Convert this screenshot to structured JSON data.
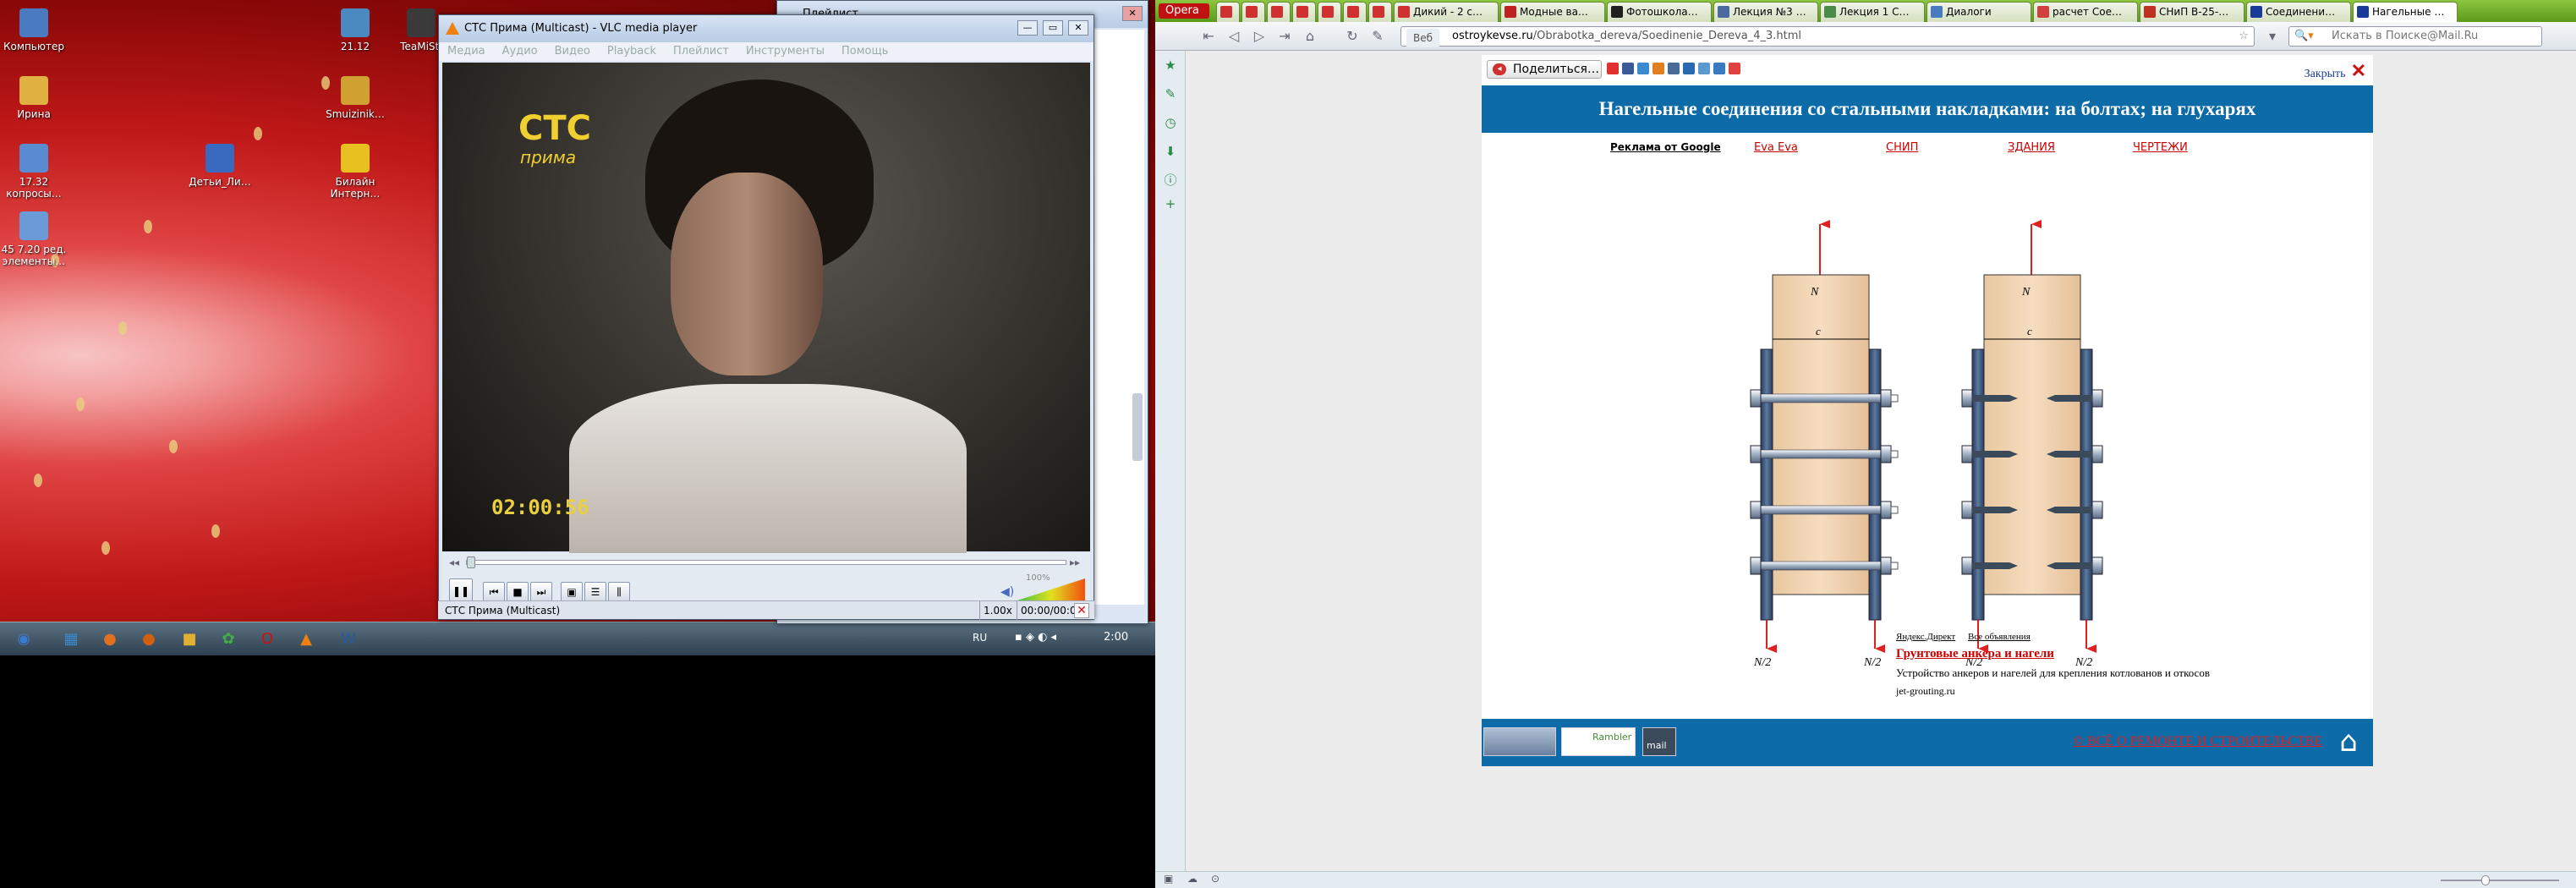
{
  "desktop": {
    "icons": [
      {
        "label": "Компьютер",
        "color": "#4a7ac0"
      },
      {
        "label": "Ирина",
        "color": "#e0b040"
      },
      {
        "label": "17.32 копросы…",
        "color": "#5a8ad0"
      },
      {
        "label": "45 7.20 ред. элементы…",
        "color": "#6a9ad8"
      },
      {
        "label": "21.12",
        "color": "#4a8ac0"
      },
      {
        "label": "TeaMiStI",
        "color": "#3a3a3a"
      },
      {
        "label": "Smuizinik…",
        "color": "#d0a030"
      },
      {
        "label": "Детьи_Ли…",
        "color": "#3a6ac0"
      },
      {
        "label": "Билайн Интерн…",
        "color": "#e8c020"
      }
    ]
  },
  "taskbar": {
    "lang": "RU",
    "clock": "2:00",
    "items": [
      {
        "name": "start-button",
        "glyph": "◉",
        "color": "#3a7ad0"
      },
      {
        "name": "explorer",
        "glyph": "▦",
        "color": "#3a8ad0"
      },
      {
        "name": "firefox",
        "glyph": "●",
        "color": "#e07020"
      },
      {
        "name": "app-orange",
        "glyph": "●",
        "color": "#d06010"
      },
      {
        "name": "folder",
        "glyph": "■",
        "color": "#e0b030"
      },
      {
        "name": "icq",
        "glyph": "✿",
        "color": "#40b040"
      },
      {
        "name": "opera",
        "glyph": "O",
        "color": "#d01010"
      },
      {
        "name": "vlc",
        "glyph": "▲",
        "color": "#f08010"
      },
      {
        "name": "word",
        "glyph": "W",
        "color": "#2a5aa0"
      }
    ]
  },
  "vlc": {
    "title": "СТС Прима (Multicast) - VLC media player",
    "menu": [
      "Медиа",
      "Аудио",
      "Видео",
      "Playback",
      "Плейлист",
      "Инструменты",
      "Помощь"
    ],
    "channel_logo": "СТС",
    "channel_logo_sub": "прима",
    "timestamp": "02:00:56",
    "status_left": "СТС Прима (Multicast)",
    "speed": "1.00x",
    "time": "00:00/00:00",
    "volume": "100%"
  },
  "playlist": {
    "title": "Плейлист"
  },
  "opera": {
    "opera_label": "Opera",
    "tabs": [
      {
        "label": "",
        "color": "#d03030"
      },
      {
        "label": "",
        "color": "#d03030"
      },
      {
        "label": "",
        "color": "#d03030"
      },
      {
        "label": "",
        "color": "#d03030"
      },
      {
        "label": "",
        "color": "#d03030"
      },
      {
        "label": "",
        "color": "#d03030"
      },
      {
        "label": "",
        "color": "#d03030"
      },
      {
        "label": "Дикий - 2 с…",
        "color": "#d03030"
      },
      {
        "label": "Модные ва…",
        "color": "#c02020"
      },
      {
        "label": "Фотошкола…",
        "color": "#202020"
      },
      {
        "label": "Лекция №3 …",
        "color": "#4a6aa0"
      },
      {
        "label": "Лекция 1 С…",
        "color": "#4a8a4a"
      },
      {
        "label": "Диалоги",
        "color": "#4a7ac0"
      },
      {
        "label": "расчет Сое…",
        "color": "#d04040"
      },
      {
        "label": "СНиП В-25-…",
        "color": "#c03020"
      },
      {
        "label": "Соединени…",
        "color": "#1a3a9a"
      },
      {
        "label": "Нагельные …",
        "color": "#1a3a9a"
      }
    ],
    "address_prefix": "Веб",
    "address_domain": "ostroykevse.ru",
    "address_path": "/Obrabotka_dereva/Soedinenie_Dereva_4_3.html",
    "search_placeholder": "Искать в Поиске@Mail.Ru"
  },
  "page": {
    "share_label": "Поделиться…",
    "close_label": "Закрыть",
    "title": "Нагельные соединения со стальными накладками: на болтах; на глухарях",
    "ad_google": "Реклама от Google",
    "ad_links": [
      "Eva Eva",
      "СНИП",
      "ЗДАНИЯ",
      "ЧЕРТЕЖИ"
    ],
    "yandex_direct": "Яндекс.Директ",
    "all_ads": "Все объявления",
    "ad_title": "Грунтовые анкера и нагели",
    "ad_text": "Устройство анкеров и нагелей для крепления котлованов и откосов",
    "ad_domain": "jet-grouting.ru",
    "footer_text": "© ВСЁ О РЕМОНТЕ И СТРОИТЕЛЬСТВЕ",
    "footer_badge1": "Rambler",
    "footer_badge2": "mail"
  },
  "diagram": {
    "label_N": "N",
    "label_c": "c",
    "label_half": "N/2"
  }
}
